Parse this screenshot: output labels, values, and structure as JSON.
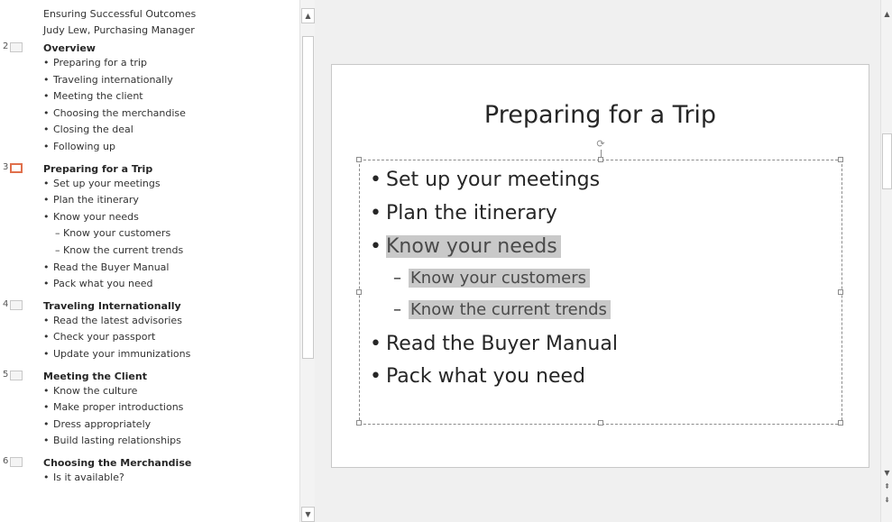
{
  "outline": {
    "intro_lines": [
      "Ensuring Successful Outcomes",
      "Judy Lew, Purchasing Manager"
    ],
    "slides": [
      {
        "number": "2",
        "title": "Overview",
        "selected": false,
        "bullets": [
          {
            "level": 1,
            "text": "Preparing for a trip"
          },
          {
            "level": 1,
            "text": "Traveling internationally"
          },
          {
            "level": 1,
            "text": "Meeting the client"
          },
          {
            "level": 1,
            "text": "Choosing the merchandise"
          },
          {
            "level": 1,
            "text": "Closing the deal"
          },
          {
            "level": 1,
            "text": "Following up"
          }
        ]
      },
      {
        "number": "3",
        "title": "Preparing for a Trip",
        "selected": true,
        "bullets": [
          {
            "level": 1,
            "text": "Set up your meetings"
          },
          {
            "level": 1,
            "text": "Plan the itinerary"
          },
          {
            "level": 1,
            "text": "Know your needs"
          },
          {
            "level": 2,
            "text": "Know your customers"
          },
          {
            "level": 2,
            "text": "Know the current trends"
          },
          {
            "level": 1,
            "text": "Read the Buyer Manual"
          },
          {
            "level": 1,
            "text": "Pack what you need"
          }
        ]
      },
      {
        "number": "4",
        "title": "Traveling Internationally",
        "selected": false,
        "bullets": [
          {
            "level": 1,
            "text": "Read the latest advisories"
          },
          {
            "level": 1,
            "text": "Check your passport"
          },
          {
            "level": 1,
            "text": "Update your immunizations"
          }
        ]
      },
      {
        "number": "5",
        "title": "Meeting the Client",
        "selected": false,
        "bullets": [
          {
            "level": 1,
            "text": "Know the culture"
          },
          {
            "level": 1,
            "text": "Make proper introductions"
          },
          {
            "level": 1,
            "text": "Dress appropriately"
          },
          {
            "level": 1,
            "text": "Build lasting relationships"
          }
        ]
      },
      {
        "number": "6",
        "title": "Choosing the Merchandise",
        "selected": false,
        "bullets": [
          {
            "level": 1,
            "text": "Is it available?"
          }
        ]
      }
    ]
  },
  "slide": {
    "title": "Preparing for a Trip",
    "bullets": [
      {
        "level": 1,
        "text": "Set up your meetings",
        "selected": false
      },
      {
        "level": 1,
        "text": "Plan the itinerary",
        "selected": false
      },
      {
        "level": 1,
        "text": "Know your needs",
        "selected": true
      },
      {
        "level": 2,
        "text": "Know your customers",
        "selected": true
      },
      {
        "level": 2,
        "text": "Know the current trends",
        "selected": true
      },
      {
        "level": 1,
        "text": "Read the Buyer Manual",
        "selected": false
      },
      {
        "level": 1,
        "text": "Pack what you need",
        "selected": false
      }
    ]
  },
  "glyphs": {
    "bullet_l1": "•",
    "bullet_l2": "–",
    "scroll_up": "▲",
    "scroll_down": "▼",
    "prev_slide": "⇞",
    "next_slide": "⇟",
    "rotate": "⟳"
  },
  "colors": {
    "selected_thumb_border": "#e0704c",
    "text_highlight": "#c9c9c9"
  },
  "icons": [
    "slide-thumbnail-icon",
    "rotate-handle-icon",
    "scroll-up-icon",
    "scroll-down-icon",
    "previous-slide-icon",
    "next-slide-icon"
  ]
}
